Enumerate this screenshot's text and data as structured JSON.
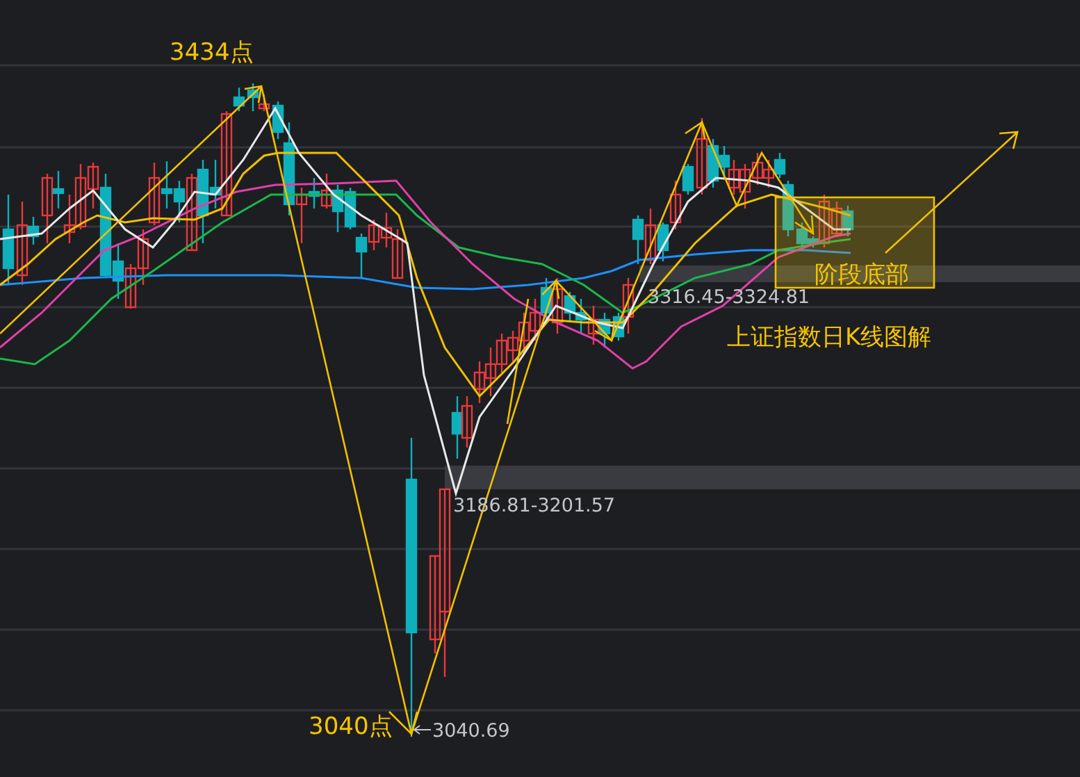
{
  "chart_title": "上证指数日K线图解",
  "peak_label": "3434点",
  "low_label": "3040点",
  "low_value": "3040.69",
  "range_labels": [
    "3186.81-3201.57",
    "3316.45-3324.81"
  ],
  "zone_label": "阶段底部"
}
